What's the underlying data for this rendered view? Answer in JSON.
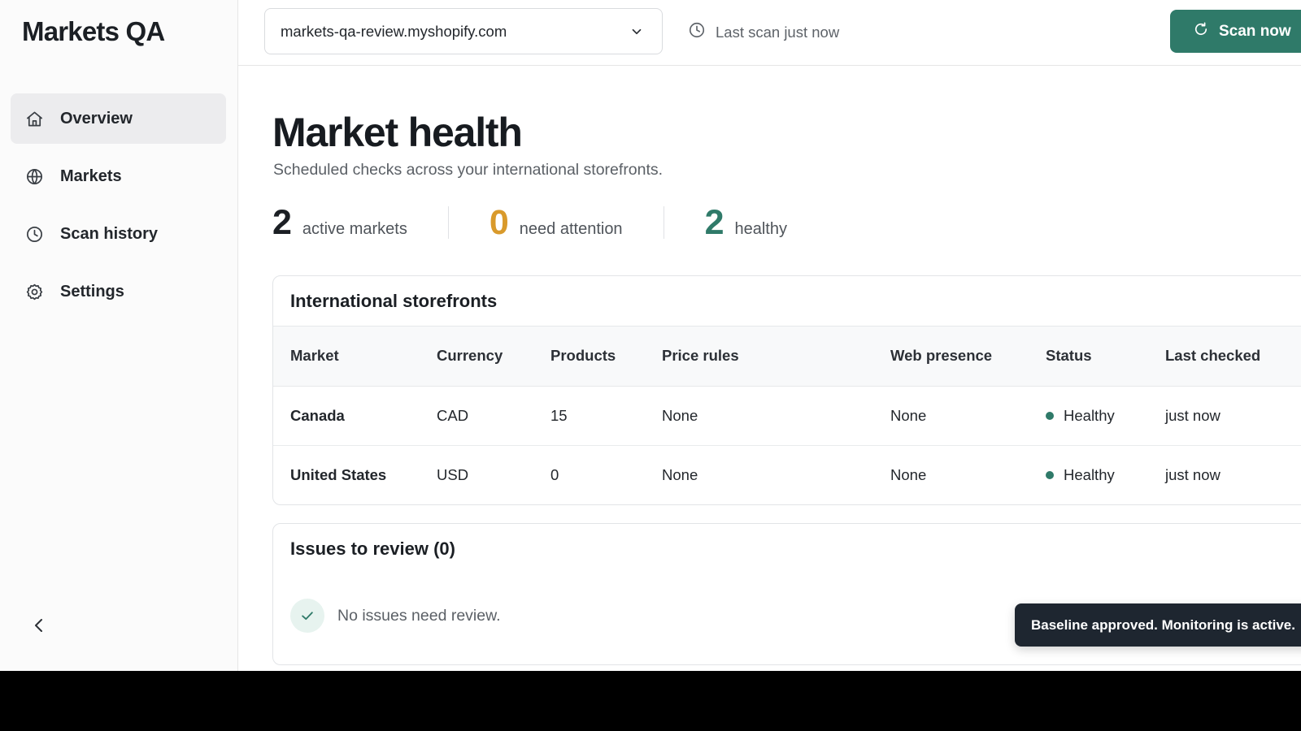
{
  "app": {
    "title": "Markets QA"
  },
  "sidebar": {
    "items": [
      {
        "label": "Overview",
        "icon": "home-icon",
        "active": true
      },
      {
        "label": "Markets",
        "icon": "globe-icon",
        "active": false
      },
      {
        "label": "Scan history",
        "icon": "clock-icon",
        "active": false
      },
      {
        "label": "Settings",
        "icon": "gear-icon",
        "active": false
      }
    ],
    "collapse_icon": "chevron-left-icon"
  },
  "topbar": {
    "store": "markets-qa-review.myshopify.com",
    "last_scan": "Last scan just now",
    "scan_button": "Scan now"
  },
  "page": {
    "title": "Market health",
    "subtitle": "Scheduled checks across your international storefronts."
  },
  "stats": [
    {
      "value": "2",
      "label": "active markets",
      "color": "#1b1f24"
    },
    {
      "value": "0",
      "label": "need attention",
      "color": "#d99a2b"
    },
    {
      "value": "2",
      "label": "healthy",
      "color": "#2f7a69"
    }
  ],
  "storefronts": {
    "title": "International storefronts",
    "columns": [
      "Market",
      "Currency",
      "Products",
      "Price rules",
      "Web presence",
      "Status",
      "Last checked"
    ],
    "rows": [
      {
        "market": "Canada",
        "currency": "CAD",
        "products": "15",
        "price_rules": "None",
        "web_presence": "None",
        "status": "Healthy",
        "last_checked": "just now"
      },
      {
        "market": "United States",
        "currency": "USD",
        "products": "0",
        "price_rules": "None",
        "web_presence": "None",
        "status": "Healthy",
        "last_checked": "just now"
      }
    ]
  },
  "issues": {
    "title": "Issues to review (0)",
    "empty_text": "No issues need review."
  },
  "toast": {
    "message": "Baseline approved. Monitoring is active."
  },
  "colors": {
    "accent": "#2f7a69",
    "warning": "#d99a2b",
    "toast_bg": "#1e2630"
  }
}
